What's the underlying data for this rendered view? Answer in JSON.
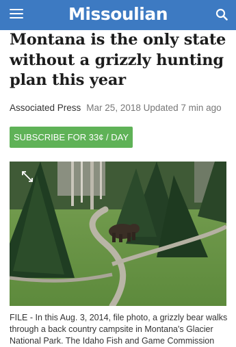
{
  "header": {
    "logo": "Missoulian",
    "menu_icon": "hamburger-menu-icon",
    "search_icon": "search-icon",
    "background": "#3d7ac2"
  },
  "article": {
    "headline": "Montana is the only state without a grizzly hunting plan this year",
    "source": "Associated Press",
    "date": "Mar 25, 2018 Updated 7 min ago"
  },
  "subscribe": {
    "label": "SUBSCRIBE FOR 33¢ / DAY",
    "color": "#5fb257"
  },
  "photo": {
    "expand_icon": "expand-icon",
    "caption": "FILE - In this Aug. 3, 2014, file photo, a grizzly bear walks through a back country campsite in Montana's Glacier National Park. The Idaho Fish and Game Commission"
  }
}
